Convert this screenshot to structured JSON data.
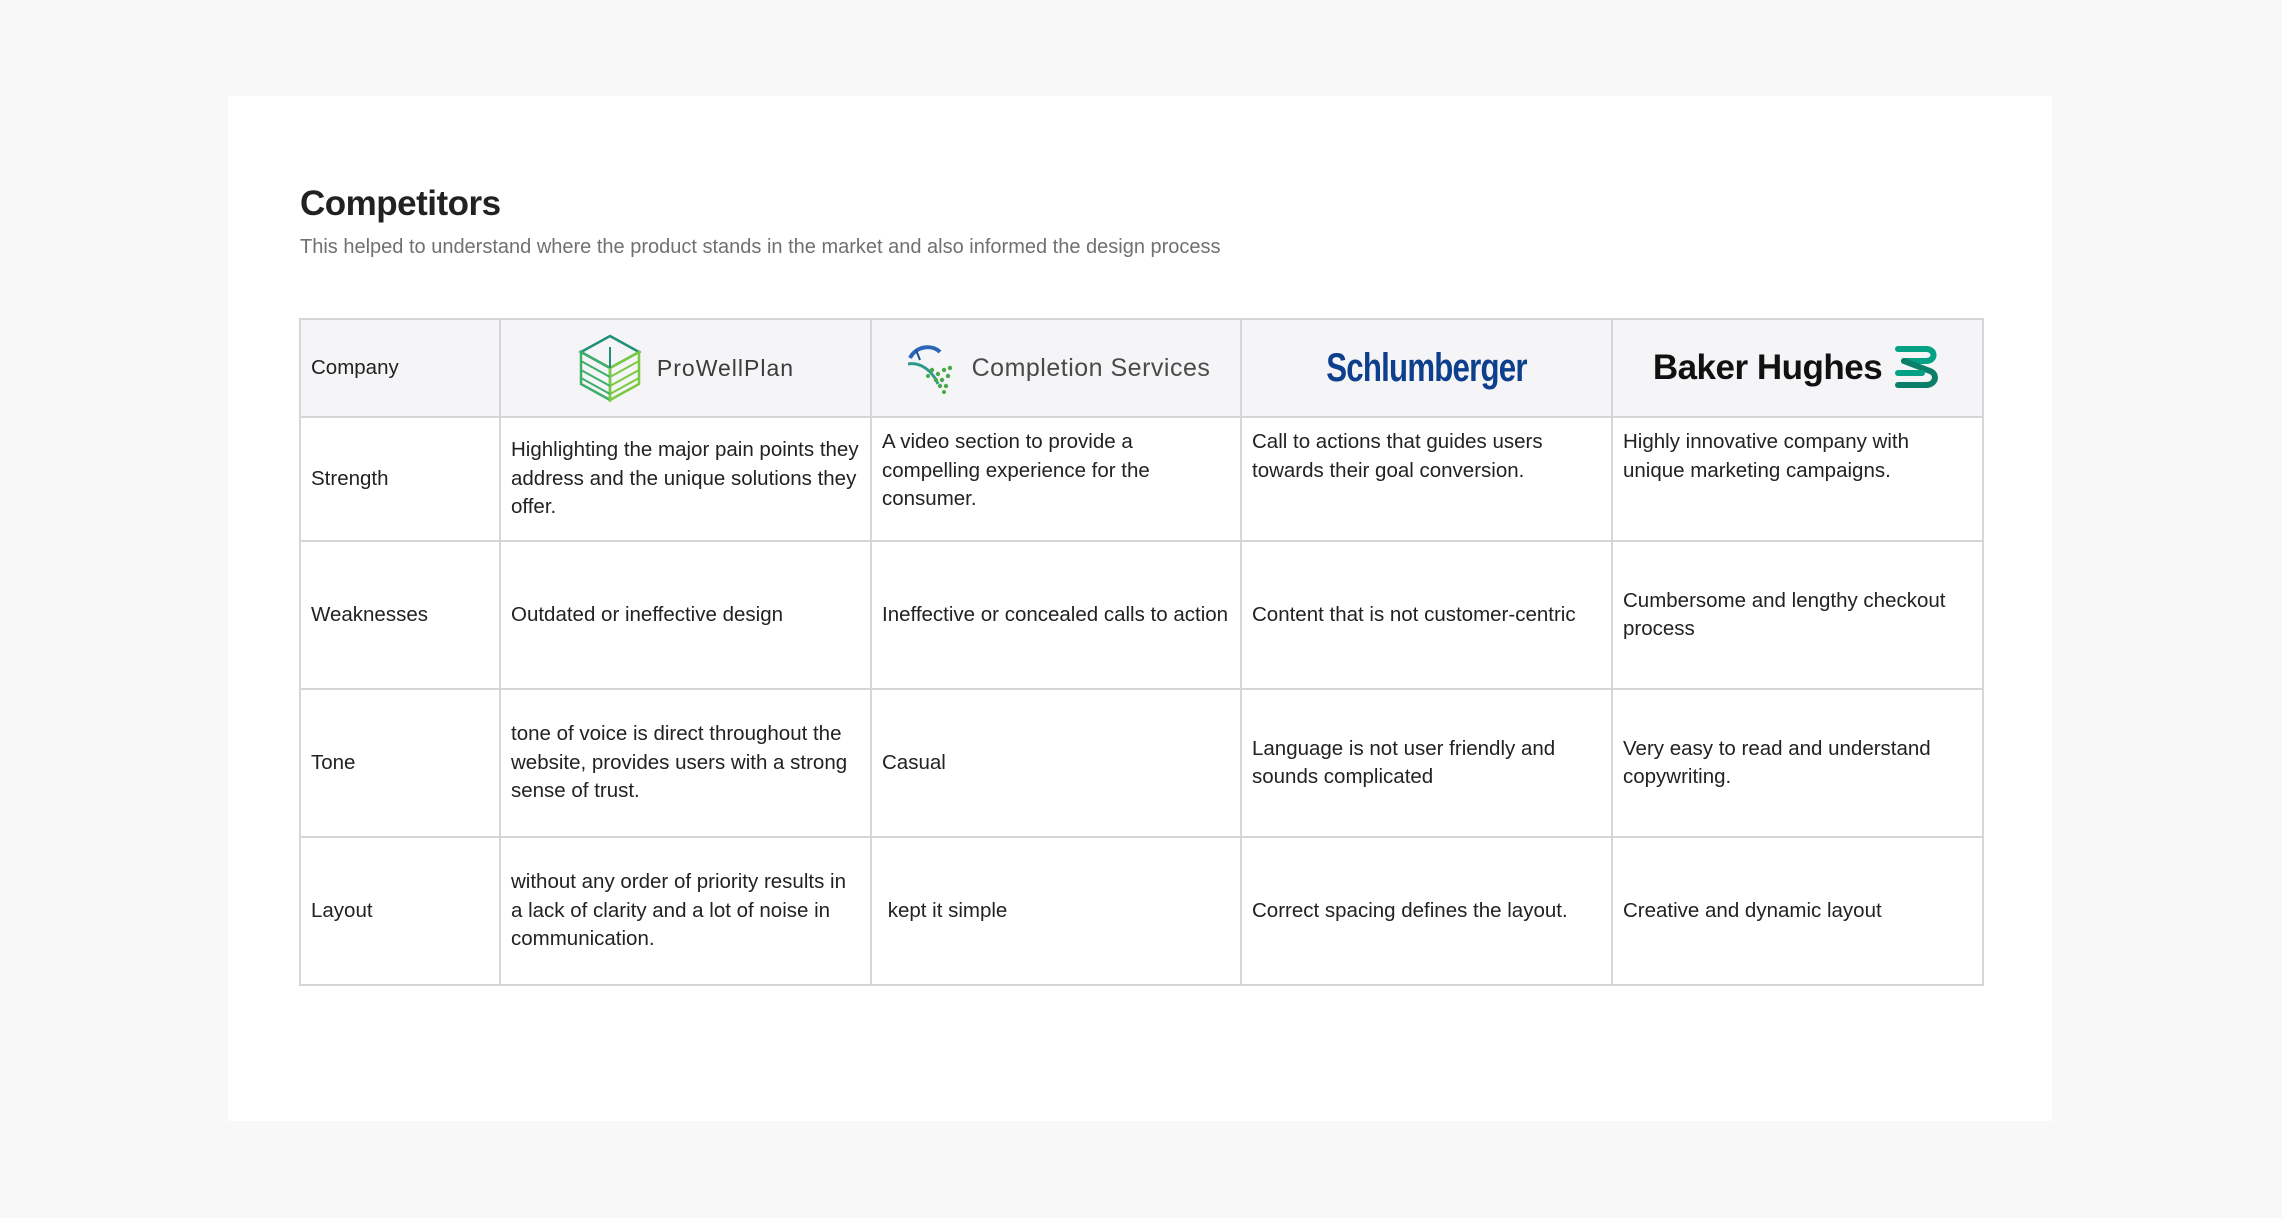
{
  "header": {
    "title": "Competitors",
    "subtitle": "This helped to understand where the product stands in the market and also informed the design process"
  },
  "table": {
    "company_label": "Company",
    "companies": [
      {
        "name": "ProWellPlan",
        "icon": "prowellplan-logo-icon"
      },
      {
        "name": "Completion Services",
        "icon": "completion-services-logo-icon"
      },
      {
        "name": "Schlumberger",
        "icon": "schlumberger-wordmark"
      },
      {
        "name": "Baker Hughes",
        "icon": "baker-hughes-logo-icon"
      }
    ],
    "rows": [
      {
        "label": "Strength",
        "cells": [
          "Highlighting the major pain points they address and the unique solutions they offer.",
          "A video section to provide a compelling experience for the consumer.",
          "Call to actions that guides users towards their goal conversion.",
          "Highly innovative company with unique marketing campaigns."
        ]
      },
      {
        "label": "Weaknesses",
        "cells": [
          "Outdated or ineffective design",
          "Ineffective or concealed calls to action",
          "Content that is not customer-centric",
          "Cumbersome and lengthy checkout process"
        ]
      },
      {
        "label": "Tone",
        "cells": [
          "tone of voice is direct throughout the website, provides users with a strong sense of trust.",
          "Casual",
          "Language is not user friendly and sounds complicated",
          "Very easy to read and understand copywriting."
        ]
      },
      {
        "label": "Layout",
        "cells": [
          "without any order of priority results in a lack of clarity and a lot of noise in communication.",
          " kept it simple",
          "Correct spacing defines the layout.",
          "Creative and dynamic layout"
        ]
      }
    ]
  },
  "colors": {
    "page_bg": "#f8f8f8",
    "card_bg": "#ffffff",
    "header_bg": "#f5f5f7",
    "border": "#d6d6d6",
    "prowellplan_green": "#3fae6a",
    "schlumberger_blue": "#0e3f8c",
    "baker_hughes_teal": "#05a184"
  }
}
